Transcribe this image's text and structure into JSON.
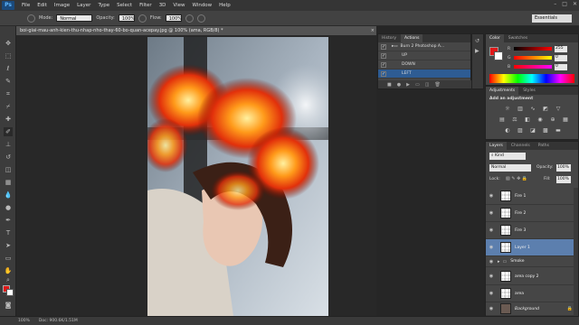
{
  "menu": {
    "logo": "Ps",
    "items": [
      "File",
      "Edit",
      "Image",
      "Layer",
      "Type",
      "Select",
      "Filter",
      "3D",
      "View",
      "Window",
      "Help"
    ]
  },
  "options": {
    "mode_label": "Mode:",
    "mode_value": "Normal",
    "opacity_label": "Opacity:",
    "opacity_value": "100%",
    "flow_label": "Flow:",
    "flow_value": "100%",
    "workspace": "Essentials"
  },
  "document": {
    "tab_title": "boi-giai-mau-anh-kien-thu-nhap-nho-thay-60-bo-quan-acepay.jpg @ 100% (ama, RGB/8) *",
    "close": "×"
  },
  "status": {
    "zoom": "100%",
    "doc": "Doc: 900.6K/1.51M"
  },
  "actions": {
    "tabs": [
      "History",
      "Actions"
    ],
    "items": [
      {
        "label": "Burn 2 Photoshop A..."
      },
      {
        "label": "UP"
      },
      {
        "label": "DOWN"
      },
      {
        "label": "LEFT"
      }
    ]
  },
  "color": {
    "tabs": [
      "Color",
      "Swatches"
    ],
    "channels": [
      {
        "ch": "R",
        "value": "255",
        "grad": "linear-gradient(90deg,#000,#f00)"
      },
      {
        "ch": "G",
        "value": "0",
        "grad": "linear-gradient(90deg,#f00,#ff0)"
      },
      {
        "ch": "B",
        "value": "0",
        "grad": "linear-gradient(90deg,#f00,#f0f)"
      }
    ],
    "fg": "#e01818",
    "bg": "#ffffff"
  },
  "adjustments": {
    "tabs": [
      "Adjustments",
      "Styles"
    ],
    "heading": "Add an adjustment"
  },
  "layers": {
    "tabs": [
      "Layers",
      "Channels",
      "Paths"
    ],
    "kind": "Kind",
    "blend": "Normal",
    "opacity_label": "Opacity:",
    "opacity": "100%",
    "lock_label": "Lock:",
    "fill_label": "Fill:",
    "fill": "100%",
    "items": [
      {
        "name": "Fire 1"
      },
      {
        "name": "Fire 2"
      },
      {
        "name": "Fire 3"
      },
      {
        "name": "Layer 1"
      },
      {
        "name": "Smoke"
      },
      {
        "name": "area copy 2"
      },
      {
        "name": "area"
      },
      {
        "name": "Background"
      }
    ]
  },
  "colors": {
    "accent": "#2e5c93",
    "layer_selected": "#5c7fae"
  }
}
